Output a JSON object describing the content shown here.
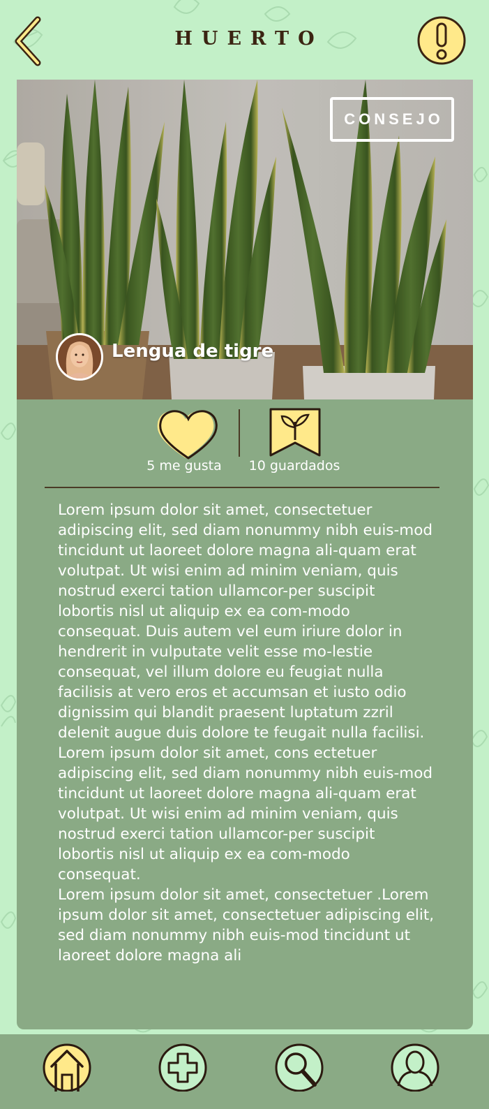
{
  "header": {
    "title": "HUERTO"
  },
  "post": {
    "tip_button": "CONSEJO",
    "plant_name": "Lengua de tigre",
    "likes_label": "5 me gusta",
    "saves_label": "10 guardados",
    "paragraphs": [
      "Lorem ipsum dolor sit amet, consectetuer adipiscing elit, sed diam nonummy nibh euis-mod tincidunt ut laoreet dolore magna ali-quam erat volutpat. Ut wisi enim ad minim veniam, quis nostrud exerci tation ullamcor-per suscipit lobortis nisl ut aliquip ex ea com-modo consequat. Duis autem vel eum iriure dolor in hendrerit in vulputate velit esse mo-lestie consequat, vel illum dolore eu feugiat nulla facilisis at vero eros et accumsan et iusto odio dignissim qui blandit praesent luptatum zzril delenit augue duis dolore te feugait nulla facilisi.",
      "Lorem ipsum dolor sit amet, cons ectetuer adipiscing elit, sed diam nonummy nibh euis-mod tincidunt ut laoreet dolore magna ali-quam erat volutpat. Ut wisi enim ad minim veniam, quis nostrud exerci tation ullamcor-per suscipit lobortis nisl ut aliquip ex ea com-modo consequat.",
      "Lorem ipsum dolor sit amet, consectetuer .Lorem ipsum dolor sit amet, consectetuer adipiscing elit, sed diam nonummy nibh euis-mod tincidunt ut laoreet dolore magna ali"
    ]
  },
  "nav": {
    "items": [
      {
        "icon": "home-icon",
        "active": true
      },
      {
        "icon": "add-icon",
        "active": false
      },
      {
        "icon": "search-icon",
        "active": false
      },
      {
        "icon": "profile-icon",
        "active": false
      }
    ]
  },
  "colors": {
    "background": "#c3f0c8",
    "card": "#8aaa85",
    "accent_yellow": "#ffe98a",
    "outline": "#3b2412",
    "text_light": "#ffffff"
  }
}
